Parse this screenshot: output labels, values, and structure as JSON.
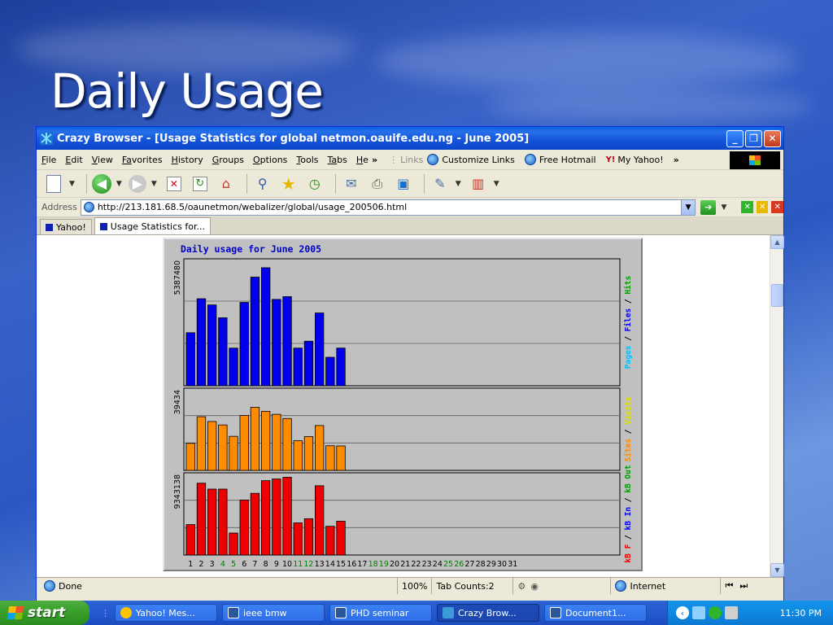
{
  "slide": {
    "title": "Daily Usage"
  },
  "window": {
    "title": "Crazy Browser - [Usage Statistics for global netmon.oauife.edu.ng - June 2005]",
    "buttons": {
      "minimize": "_",
      "maximize": "❐",
      "close": "✕"
    }
  },
  "menu": {
    "items": [
      {
        "key": "F",
        "rest": "ile"
      },
      {
        "key": "E",
        "rest": "dit"
      },
      {
        "key": "V",
        "rest": "iew"
      },
      {
        "key": "Fa",
        "rest": "vorites",
        "prefix": ""
      },
      {
        "key": "H",
        "rest": "istory"
      },
      {
        "key": "G",
        "rest": "roups"
      },
      {
        "key": "O",
        "rest": "ptions"
      },
      {
        "key": "T",
        "rest": "ools"
      },
      {
        "key": "Ta",
        "rest": "bs"
      },
      {
        "key": "H",
        "rest": "e"
      }
    ],
    "overflow": "»",
    "links_label": "Links",
    "links": [
      "Customize Links",
      "Free Hotmail",
      "My Yahoo!"
    ],
    "links_overflow": "»"
  },
  "toolbar": {
    "icons": [
      "new-page-icon",
      "back-icon",
      "forward-icon",
      "stop-icon",
      "refresh-icon",
      "home-icon",
      "search-icon",
      "favorites-icon",
      "history-icon",
      "mail-icon",
      "print-icon",
      "window-icon",
      "edit-icon",
      "tools-icon"
    ]
  },
  "address": {
    "label": "Address",
    "url": "http://213.181.68.5/oaunetmon/webalizer/global/usage_200506.html"
  },
  "tabs": [
    {
      "label": "Yahoo!",
      "active": false
    },
    {
      "label": "Usage Statistics for...",
      "active": true
    }
  ],
  "status": {
    "text": "Done",
    "zoom": "100%",
    "tab_counts": "Tab Counts:2",
    "zone": "Internet"
  },
  "chart_data": {
    "type": "bar",
    "title": "Daily usage for June 2005",
    "x": [
      "1",
      "2",
      "3",
      "4",
      "5",
      "6",
      "7",
      "8",
      "9",
      "10",
      "11",
      "12",
      "13",
      "14",
      "15",
      "16",
      "17",
      "18",
      "19",
      "20",
      "21",
      "22",
      "23",
      "24",
      "25",
      "26",
      "27",
      "28",
      "29",
      "30",
      "31"
    ],
    "weekend_days": [
      "4",
      "5",
      "11",
      "12",
      "18",
      "19",
      "25",
      "26"
    ],
    "panels": [
      {
        "name": "hits",
        "max_label": "5387480",
        "ymax": 5387480,
        "color": "#0000ee",
        "side_label": [
          {
            "text": "Pages",
            "color": "#00c0ff"
          },
          {
            "text": " / ",
            "color": "#000000"
          },
          {
            "text": "Files",
            "color": "#0000ee"
          },
          {
            "text": " / ",
            "color": "#000000"
          },
          {
            "text": "Hits",
            "color": "#00a000"
          }
        ],
        "values": [
          2310000,
          3790000,
          3520000,
          2960000,
          1640000,
          3630000,
          4730000,
          5140000,
          3760000,
          3880000,
          1640000,
          1940000,
          3170000,
          1240000,
          1640000
        ]
      },
      {
        "name": "visits",
        "max_label": "39434",
        "ymax": 39434,
        "color": "#ff8c00",
        "side_label": [
          {
            "text": "Sites",
            "color": "#ff8c00"
          },
          {
            "text": " / ",
            "color": "#000000"
          },
          {
            "text": "Visits",
            "color": "#e0e000"
          }
        ],
        "values": [
          13500,
          26800,
          24400,
          22700,
          17000,
          27400,
          31500,
          29500,
          28000,
          25900,
          14800,
          16900,
          22400,
          12300,
          12200
        ]
      },
      {
        "name": "kbytes",
        "max_label": "9343138",
        "ymax": 9343138,
        "color": "#ee0000",
        "side_label": [
          {
            "text": "kB F",
            "color": "#ee0000"
          },
          {
            "text": " / ",
            "color": "#000000"
          },
          {
            "text": "kB In",
            "color": "#0000ee"
          },
          {
            "text": " / ",
            "color": "#000000"
          },
          {
            "text": "kB Out",
            "color": "#00a000"
          }
        ],
        "values": [
          3600000,
          8500000,
          7800000,
          7800000,
          2600000,
          6500000,
          7300000,
          8800000,
          9000000,
          9200000,
          3800000,
          4300000,
          8200000,
          3400000,
          4000000
        ]
      }
    ]
  },
  "taskbar": {
    "start": "start",
    "items": [
      {
        "label": "Yahoo! Mes...",
        "icon_color": "#ffc400",
        "active": false
      },
      {
        "label": "ieee bmw",
        "icon_color": "#2b579a",
        "active": false
      },
      {
        "label": "PHD seminar",
        "icon_color": "#2b579a",
        "active": false
      },
      {
        "label": "Crazy Brow...",
        "icon_color": "#3b9bd9",
        "active": true
      },
      {
        "label": "Document1...",
        "icon_color": "#2b579a",
        "active": false
      }
    ],
    "clock": "11:30 PM"
  }
}
